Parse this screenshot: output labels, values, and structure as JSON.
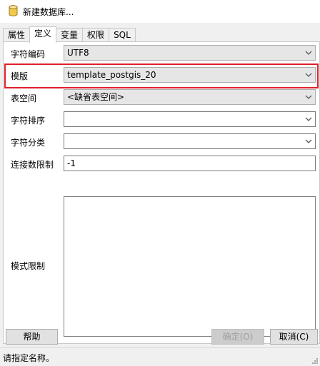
{
  "window": {
    "title": "新建数据库...",
    "title_icon": "database-icon"
  },
  "tabs": [
    {
      "label": "属性",
      "active": false
    },
    {
      "label": "定义",
      "active": true
    },
    {
      "label": "变量",
      "active": false
    },
    {
      "label": "权限",
      "active": false
    },
    {
      "label": "SQL",
      "active": false
    }
  ],
  "form": {
    "encoding": {
      "label": "字符编码",
      "value": "UTF8"
    },
    "template": {
      "label": "模版",
      "value": "template_postgis_20"
    },
    "tablespace": {
      "label": "表空间",
      "value": "<缺省表空间>"
    },
    "collation": {
      "label": "字符排序",
      "value": ""
    },
    "ctype": {
      "label": "字符分类",
      "value": ""
    },
    "connection_limit": {
      "label": "连接数限制",
      "value": "-1"
    },
    "schema_restriction": {
      "label": "模式限制",
      "value": ""
    }
  },
  "buttons": {
    "help": "帮助",
    "ok": "确定(O)",
    "cancel": "取消(C)"
  },
  "status": {
    "text": "请指定名称。"
  },
  "colors": {
    "highlight_border": "#e0202a",
    "chevron": "#5a5a5a"
  }
}
